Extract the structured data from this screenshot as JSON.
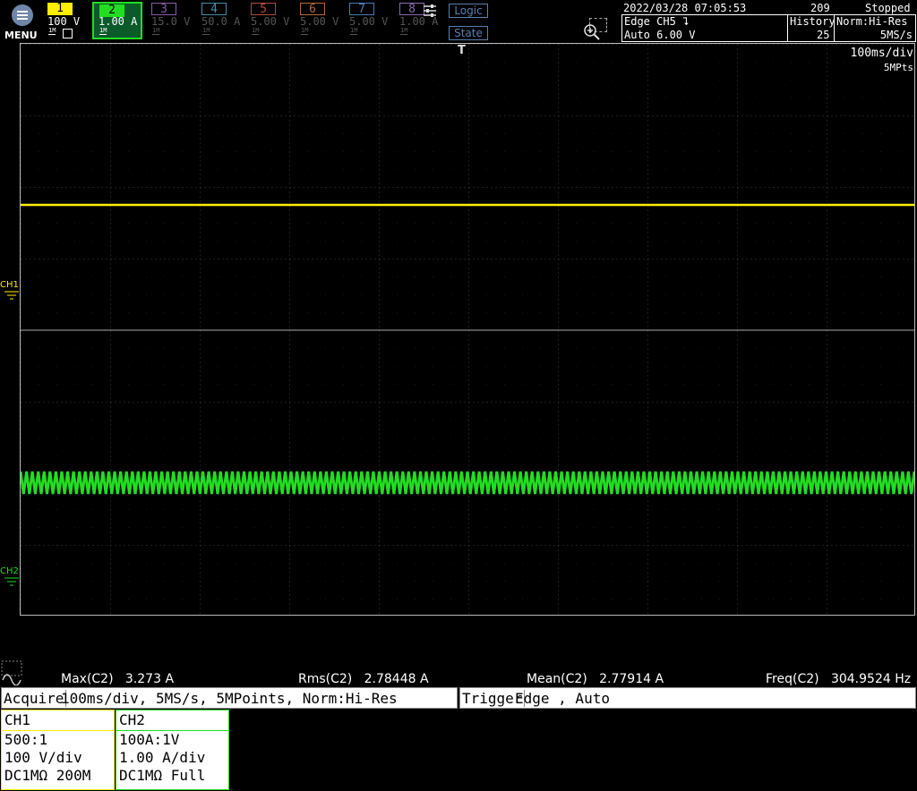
{
  "menu": {
    "label": "MENU"
  },
  "channels": [
    {
      "num": "1",
      "scale": "100 V",
      "color": "#ffee00",
      "state": "active"
    },
    {
      "num": "2",
      "scale": "1.00 A",
      "color": "#22dd22",
      "state": "selected"
    },
    {
      "num": "3",
      "scale": "15.0 V",
      "color": "#8a5aa8",
      "state": "off"
    },
    {
      "num": "4",
      "scale": "50.0 A",
      "color": "#4a8aa8",
      "state": "off"
    },
    {
      "num": "5",
      "scale": "5.00 V",
      "color": "#b04a3a",
      "state": "off"
    },
    {
      "num": "6",
      "scale": "5.00 V",
      "color": "#b06a3a",
      "state": "off"
    },
    {
      "num": "7",
      "scale": "5.00 V",
      "color": "#4a7ab0",
      "state": "off"
    },
    {
      "num": "8",
      "scale": "1.00 A",
      "color": "#8a6ab0",
      "state": "off"
    }
  ],
  "impedance_tag": "1M",
  "logic": {
    "logic_label": "Logic",
    "state_label": "State"
  },
  "status": {
    "datetime": "2022/03/28 07:05:53",
    "count": "209",
    "run_state": "Stopped",
    "trigger_line1": "Edge CH5 ⮧",
    "trigger_line2": "Auto 6.00 V",
    "history_label": "History",
    "history_value": "25",
    "acq_mode": "Norm:Hi-Res",
    "sample_rate": "5MS/s"
  },
  "timebase": {
    "per_div": "100ms/div",
    "points": "5MPts"
  },
  "trigger_marker": "T",
  "ch_markers": {
    "ch1": "CH1",
    "ch2": "CH2"
  },
  "measurements": [
    {
      "label": "Max(C2)",
      "value": "3.273 A"
    },
    {
      "label": "Rms(C2)",
      "value": "2.78448 A"
    },
    {
      "label": "Mean(C2)",
      "value": "2.77914 A"
    },
    {
      "label": "Freq(C2)",
      "value": "304.9524 Hz"
    }
  ],
  "acquire": {
    "label": "Acquire",
    "text": "100ms/div, 5MS/s, 5MPoints, Norm:Hi-Res"
  },
  "trigger": {
    "label": "Trigger",
    "text": "Edge , Auto"
  },
  "ch1_panel": {
    "title": "CH1",
    "line1": "500:1",
    "line2": "100 V/div",
    "line3": "DC1MΩ 200M"
  },
  "ch2_panel": {
    "title": "CH2",
    "line1": "100A:1V",
    "line2": "1.00 A/div",
    "line3": "DC1MΩ Full"
  },
  "colors": {
    "ch1": "#ffee00",
    "ch2": "#22dd22",
    "ch2_box": "#0b5a2a"
  }
}
